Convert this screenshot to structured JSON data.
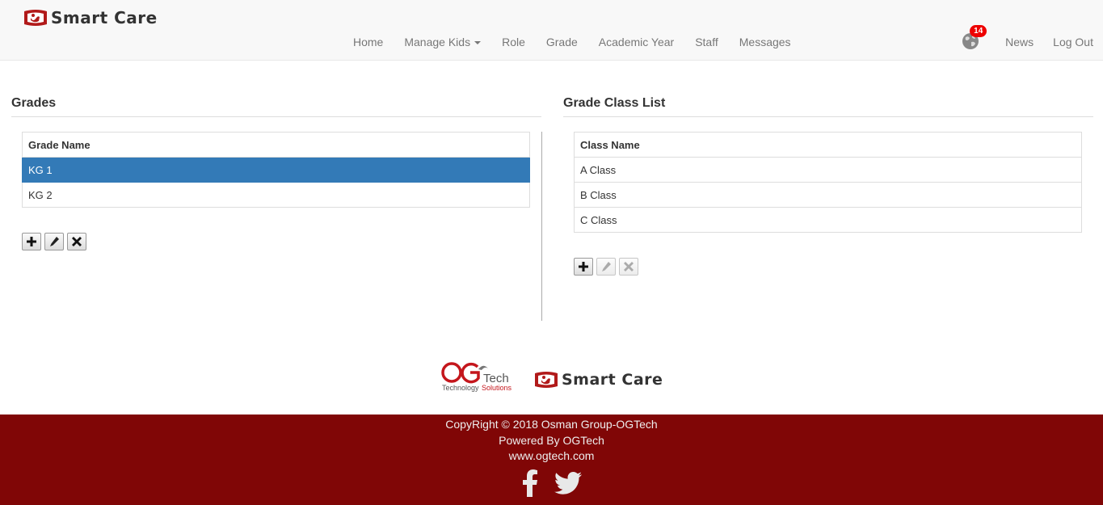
{
  "brand": {
    "name": "Smart Care"
  },
  "nav": {
    "items": [
      "Home",
      "Manage Kids",
      "Role",
      "Grade",
      "Academic Year",
      "Staff",
      "Messages"
    ],
    "notification_count": "14",
    "right": [
      "News",
      "Log Out"
    ]
  },
  "grades": {
    "title": "Grades",
    "header": "Grade Name",
    "rows": [
      "KG 1",
      "KG 2"
    ],
    "selected": "KG 1"
  },
  "classes": {
    "title": "Grade Class List",
    "header": "Class Name",
    "rows": [
      "A Class",
      "B Class",
      "C Class"
    ]
  },
  "footer": {
    "og_brand": "OG",
    "og_tech": "Tech",
    "og_tagline_1": "Technology",
    "og_tagline_2": "Solutions",
    "smart_care": "Smart Care",
    "copyright": "CopyRight © 2018 Osman Group-OGTech",
    "powered": "Powered By OGTech",
    "website": "www.ogtech.com"
  },
  "colors": {
    "selected_row": "#337ab7",
    "footer_bg": "#800606",
    "badge": "#ee0000",
    "brand_red": "#b11a1a"
  },
  "icons": [
    "globe-icon",
    "plus-icon",
    "pencil-icon",
    "close-icon",
    "facebook-icon",
    "twitter-icon"
  ]
}
